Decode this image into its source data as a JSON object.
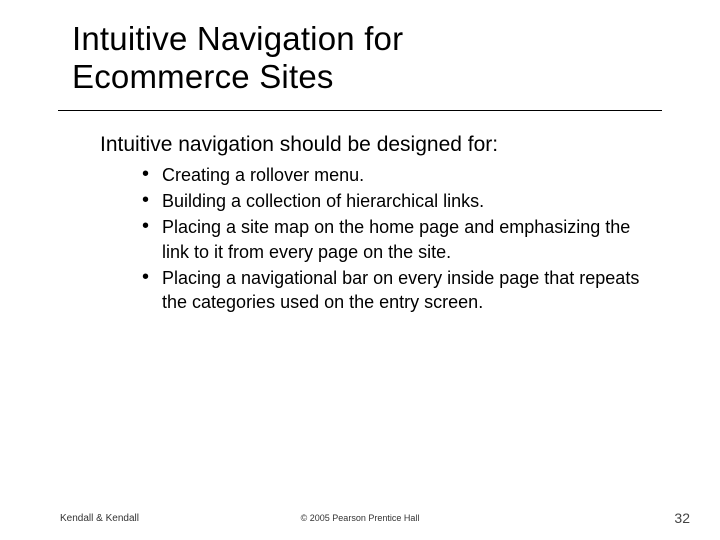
{
  "title_line1": "Intuitive Navigation for",
  "title_line2": "Ecommerce Sites",
  "lead": "Intuitive navigation should be designed for:",
  "bullets": [
    "Creating a rollover menu.",
    "Building a collection of hierarchical links.",
    "Placing a site map on the home page and emphasizing the link to it from every page on the site.",
    "Placing a navigational bar on every inside page that repeats the categories used on the entry screen."
  ],
  "footer": {
    "left": "Kendall & Kendall",
    "center": "© 2005 Pearson Prentice Hall",
    "right": "32"
  }
}
